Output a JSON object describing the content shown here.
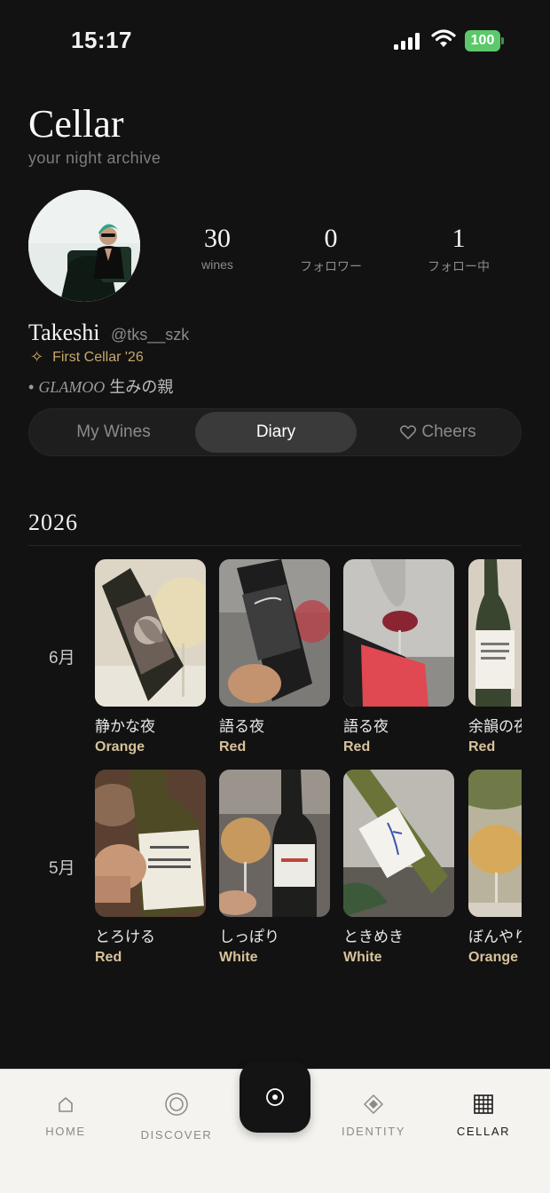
{
  "status_bar": {
    "time": "15:17",
    "battery": "100"
  },
  "header": {
    "title": "Cellar",
    "subtitle": "your night archive"
  },
  "profile": {
    "stats": [
      {
        "value": "30",
        "label": "wines"
      },
      {
        "value": "0",
        "label": "フォロワー"
      },
      {
        "value": "1",
        "label": "フォロー中"
      }
    ],
    "name": "Takeshi",
    "handle": "@tks__szk",
    "badge": "First Cellar '26",
    "bio_brand": "GLAMOO",
    "bio_text": "生みの親"
  },
  "tabs": [
    {
      "label": "My Wines",
      "active": false
    },
    {
      "label": "Diary",
      "active": true
    },
    {
      "label": "Cheers",
      "active": false
    }
  ],
  "diary": {
    "year": "2026",
    "months": [
      {
        "label": "6月",
        "entries": [
          {
            "title": "静かな夜",
            "type": "Orange"
          },
          {
            "title": "語る夜",
            "type": "Red"
          },
          {
            "title": "語る夜",
            "type": "Red"
          },
          {
            "title": "余韻の夜",
            "type": "Red"
          }
        ]
      },
      {
        "label": "5月",
        "entries": [
          {
            "title": "とろける",
            "type": "Red"
          },
          {
            "title": "しっぽり",
            "type": "White"
          },
          {
            "title": "ときめき",
            "type": "White"
          },
          {
            "title": "ぼんやり",
            "type": "Orange"
          }
        ]
      }
    ]
  },
  "nav": [
    {
      "label": "HOME",
      "icon": "home-icon"
    },
    {
      "label": "DISCOVER",
      "icon": "discover-icon"
    },
    {
      "label": "",
      "icon": "record-icon"
    },
    {
      "label": "IDENTITY",
      "icon": "diamond-icon"
    },
    {
      "label": "CELLAR",
      "icon": "grid-icon"
    }
  ]
}
